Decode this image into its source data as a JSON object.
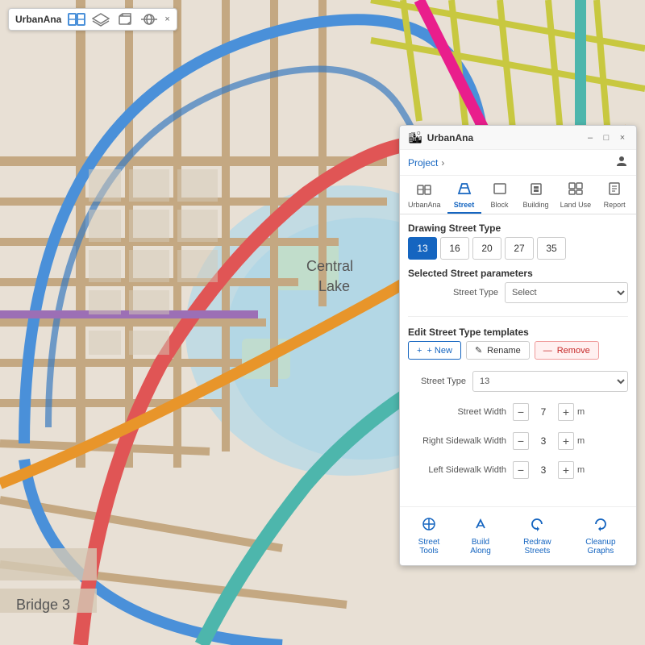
{
  "toolbar": {
    "title": "UrbanAna",
    "close": "×",
    "icons": [
      "map-icon",
      "layers-icon",
      "3d-icon",
      "satellite-icon"
    ]
  },
  "panel": {
    "title": "UrbanAna",
    "breadcrumb": "Project",
    "breadcrumb_arrow": "›",
    "window_buttons": [
      "–",
      "□",
      "×"
    ],
    "tabs": [
      {
        "id": "urbanana",
        "label": "UrbanAna",
        "icon": "🗺"
      },
      {
        "id": "street",
        "label": "Street",
        "icon": "🏠",
        "active": true
      },
      {
        "id": "block",
        "label": "Block",
        "icon": "⬜"
      },
      {
        "id": "building",
        "label": "Building",
        "icon": "🏢"
      },
      {
        "id": "landuse",
        "label": "Land Use",
        "icon": "⊞"
      },
      {
        "id": "report",
        "label": "Report",
        "icon": "📋"
      }
    ],
    "drawing_street_type": {
      "label": "Drawing Street Type",
      "types": [
        "13",
        "16",
        "20",
        "27",
        "35"
      ],
      "active": "13"
    },
    "selected_street_params": {
      "label": "Selected Street parameters",
      "street_type_label": "Street Type",
      "street_type_placeholder": "Select"
    },
    "edit_templates": {
      "label": "Edit Street Type templates",
      "new_label": "+ New",
      "rename_label": "✎ Rename",
      "remove_label": "— Remove"
    },
    "street_type_field": {
      "label": "Street Type",
      "value": "13"
    },
    "street_width": {
      "label": "Street Width",
      "value": "7",
      "unit": "m"
    },
    "right_sidewalk": {
      "label": "Right Sidewalk Width",
      "value": "3",
      "unit": "m"
    },
    "left_sidewalk": {
      "label": "Left Sidewalk Width",
      "value": "3",
      "unit": "m"
    },
    "footer_buttons": [
      {
        "id": "street-tools",
        "icon": "+",
        "label": "Street Tools"
      },
      {
        "id": "build-along",
        "icon": "↑",
        "label": "Build Along"
      },
      {
        "id": "redraw-streets",
        "icon": "↺",
        "label": "Redraw Streets"
      },
      {
        "id": "cleanup-graphs",
        "icon": "↺",
        "label": "Cleanup Graphs"
      }
    ]
  },
  "map": {
    "label1": "Central",
    "label2": "Lake",
    "label3": "Bridge 3"
  }
}
